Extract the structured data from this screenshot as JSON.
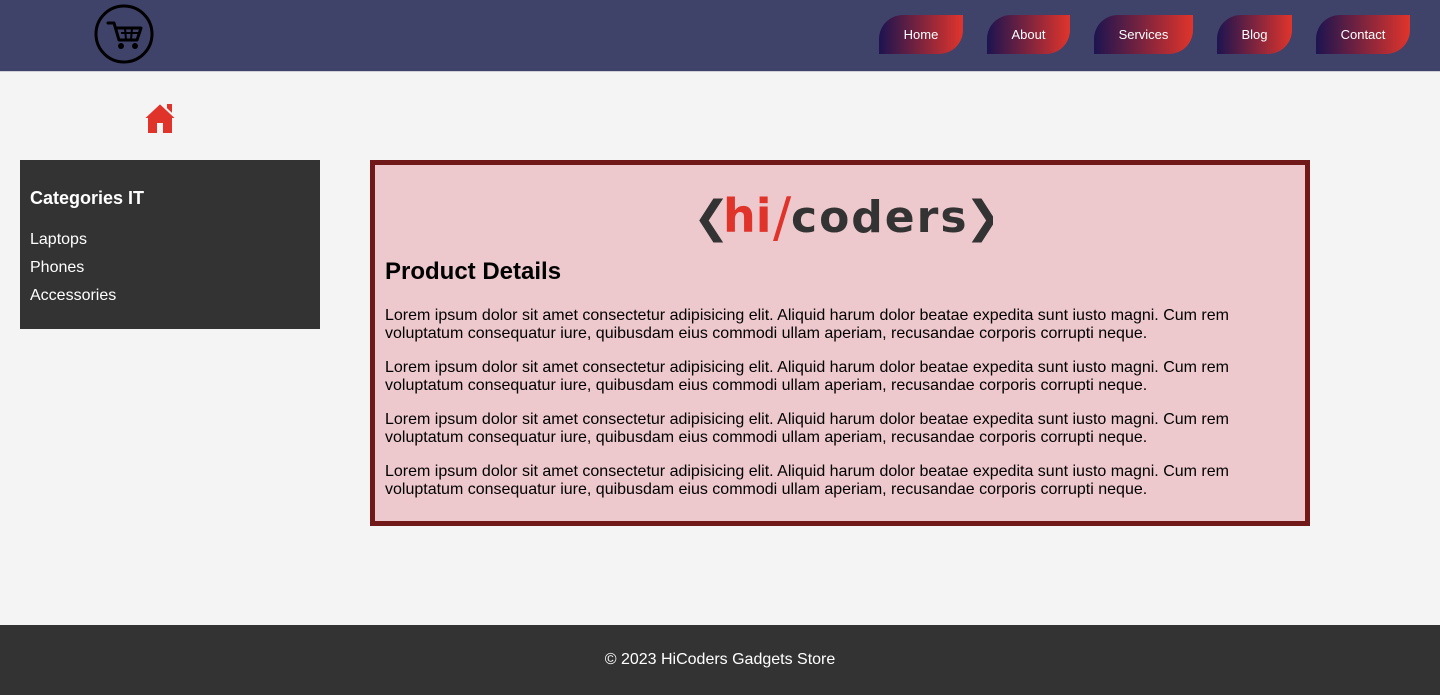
{
  "header": {
    "logo_icon": "shopping-cart-icon",
    "nav": [
      {
        "label": "Home"
      },
      {
        "label": "About"
      },
      {
        "label": "Services"
      },
      {
        "label": "Blog"
      },
      {
        "label": "Contact"
      }
    ],
    "nav_gradient": [
      "#1c1450",
      "#e0342b"
    ],
    "background": "#3f4269"
  },
  "home_icon": "home-icon",
  "sidebar": {
    "title": "Categories IT",
    "items": [
      {
        "label": "Laptops"
      },
      {
        "label": "Phones"
      },
      {
        "label": "Accessories"
      }
    ]
  },
  "content": {
    "brand": {
      "left_bracket": "❮",
      "hi": "hi",
      "slash": "/",
      "coders": "coders",
      "right_bracket": "❯"
    },
    "title": "Product Details",
    "paragraphs": [
      "Lorem ipsum dolor sit amet consectetur adipisicing elit. Aliquid harum dolor beatae expedita sunt iusto magni. Cum rem voluptatum consequatur iure, quibusdam eius commodi ullam aperiam, recusandae corporis corrupti neque.",
      "Lorem ipsum dolor sit amet consectetur adipisicing elit. Aliquid harum dolor beatae expedita sunt iusto magni. Cum rem voluptatum consequatur iure, quibusdam eius commodi ullam aperiam, recusandae corporis corrupti neque.",
      "Lorem ipsum dolor sit amet consectetur adipisicing elit. Aliquid harum dolor beatae expedita sunt iusto magni. Cum rem voluptatum consequatur iure, quibusdam eius commodi ullam aperiam, recusandae corporis corrupti neque.",
      "Lorem ipsum dolor sit amet consectetur adipisicing elit. Aliquid harum dolor beatae expedita sunt iusto magni. Cum rem voluptatum consequatur iure, quibusdam eius commodi ullam aperiam, recusandae corporis corrupti neque."
    ],
    "accent": "#e0342b",
    "border_color": "#711818",
    "background": "#edc8cc"
  },
  "footer": {
    "text": "© 2023 HiCoders Gadgets Store"
  }
}
